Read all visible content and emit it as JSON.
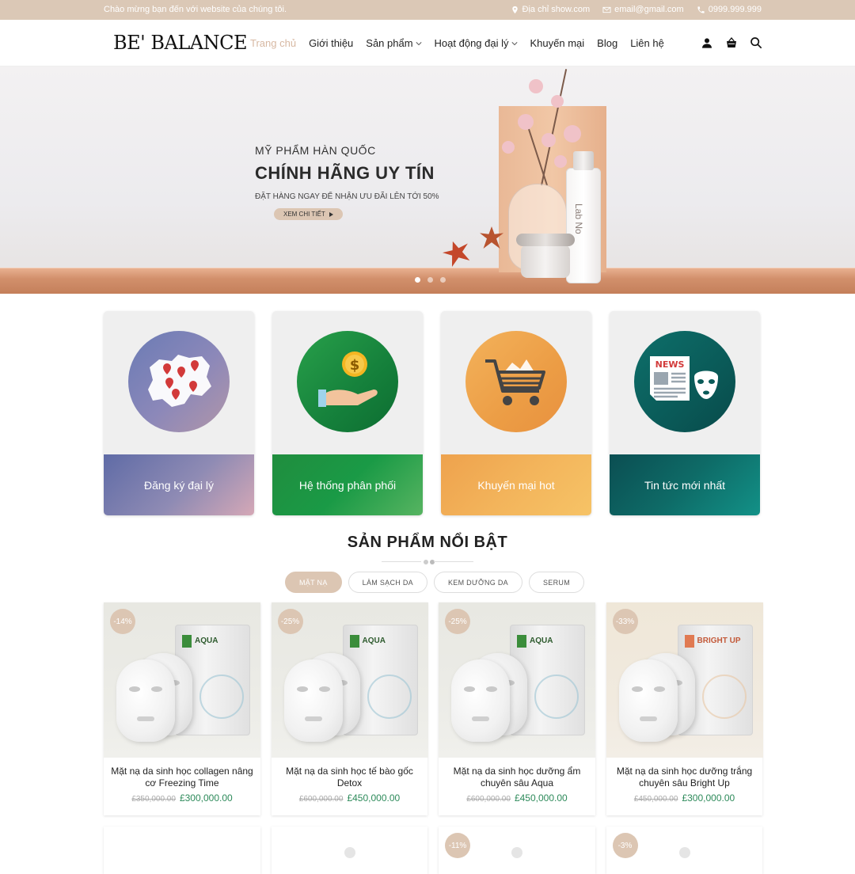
{
  "topbar": {
    "welcome": "Chào mừng bạn đến với website của chúng tôi.",
    "address": "Địa chỉ show.com",
    "email": "email@gmail.com",
    "phone": "0999.999.999"
  },
  "header": {
    "logo": "BE' BALANCE",
    "nav": [
      {
        "label": "Trang chủ",
        "active": true
      },
      {
        "label": "Giới thiệu"
      },
      {
        "label": "Sản phẩm",
        "dropdown": true
      },
      {
        "label": "Hoạt động đại lý",
        "dropdown": true
      },
      {
        "label": "Khuyến mại"
      },
      {
        "label": "Blog"
      },
      {
        "label": "Liên hệ"
      }
    ],
    "icons": [
      "user-icon",
      "cart-icon",
      "search-icon"
    ]
  },
  "hero": {
    "subtitle": "MỸ PHẨM HÀN QUỐC",
    "title": "CHÍNH HÃNG UY TÍN",
    "promo": "ĐẶT HÀNG NGAY ĐỂ NHẬN ƯU ĐÃI LÊN TỚI 50%",
    "cta": "XEM CHI TIẾT",
    "bottle_brand": "Lab No",
    "slides": 3,
    "active_slide": 1
  },
  "features": [
    {
      "label": "Đăng ký đại lý",
      "icon": "map-pins-icon"
    },
    {
      "label": "Hệ thống phân phối",
      "icon": "coin-hand-icon"
    },
    {
      "label": "Khuyến mại hot",
      "icon": "shopping-cart-icon"
    },
    {
      "label": "Tin tức mới nhất",
      "icon": "news-mask-icon",
      "icon_text": "NEWS"
    }
  ],
  "section": {
    "title": "SẢN PHẨM NỔI BẬT",
    "tabs": [
      {
        "label": "MẶT NẠ",
        "active": true
      },
      {
        "label": "LÀM SẠCH DA"
      },
      {
        "label": "KEM DƯỠNG DA"
      },
      {
        "label": "SERUM"
      }
    ]
  },
  "products": [
    {
      "badge": "-14%",
      "name": "Mặt nạ da sinh học collagen nâng cơ Freezing Time",
      "old_price": "£350,000.00",
      "price": "£300,000.00",
      "pack_label": "AQUA"
    },
    {
      "badge": "-25%",
      "name": "Mặt nạ da sinh học tế bào gốc Detox",
      "old_price": "£600,000.00",
      "price": "£450,000.00",
      "pack_label": "AQUA"
    },
    {
      "badge": "-25%",
      "name": "Mặt nạ da sinh học dưỡng ẩm chuyên sâu Aqua",
      "old_price": "£600,000.00",
      "price": "£450,000.00",
      "pack_label": "AQUA"
    },
    {
      "badge": "-33%",
      "name": "Mặt nạ da sinh học dưỡng trắng chuyên sâu Bright Up",
      "old_price": "£450,000.00",
      "price": "£300,000.00",
      "pack_label": "BRIGHT UP"
    }
  ],
  "products_row2": [
    {
      "badge": ""
    },
    {
      "badge": ""
    },
    {
      "badge": "-11%"
    },
    {
      "badge": "-3%"
    }
  ]
}
